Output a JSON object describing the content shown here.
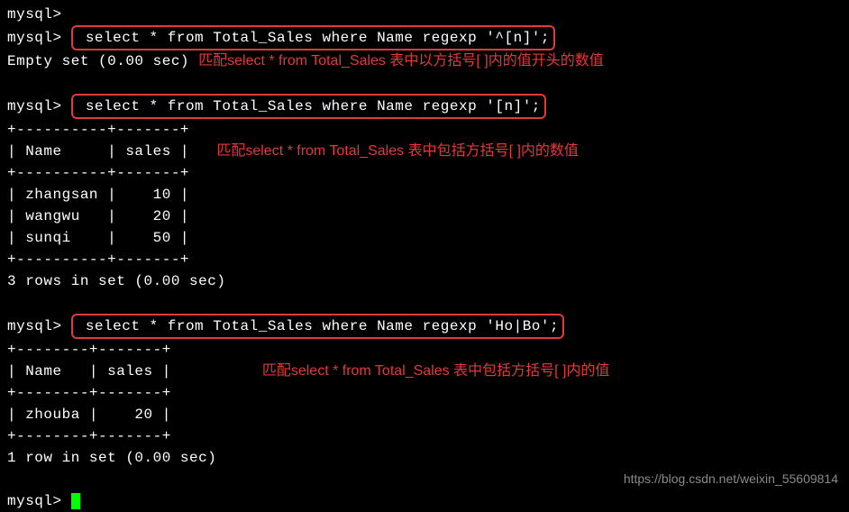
{
  "prompts": {
    "empty1": "mysql>",
    "empty2": "mysql>",
    "q1": "mysql>",
    "q2": "mysql>",
    "q3": "mysql>",
    "final": "mysql>"
  },
  "queries": {
    "q1": " select * from Total_Sales where Name regexp '^[n]';",
    "q2": " select * from Total_Sales where Name regexp '[n]';",
    "q3": " select * from Total_Sales where Name regexp 'Ho|Bo';"
  },
  "annotations": {
    "a1": "匹配select * from Total_Sales 表中以方括号[ ]内的值开头的数值",
    "a2": "匹配select * from Total_Sales 表中包括方括号[ ]内的数值",
    "a3": "匹配select * from Total_Sales 表中包括方括号[ ]内的值"
  },
  "results": {
    "empty_set": "Empty set (0.00 sec)",
    "table1": {
      "border": "+----------+-------+",
      "header": "| Name     | sales |",
      "rows": [
        "| zhangsan |    10 |",
        "| wangwu   |    20 |",
        "| sunqi    |    50 |"
      ],
      "footer": "3 rows in set (0.00 sec)"
    },
    "table2": {
      "border": "+--------+-------+",
      "header": "| Name   | sales |",
      "rows": [
        "| zhouba |    20 |"
      ],
      "footer": "1 row in set (0.00 sec)"
    }
  },
  "watermark": "https://blog.csdn.net/weixin_55609814"
}
